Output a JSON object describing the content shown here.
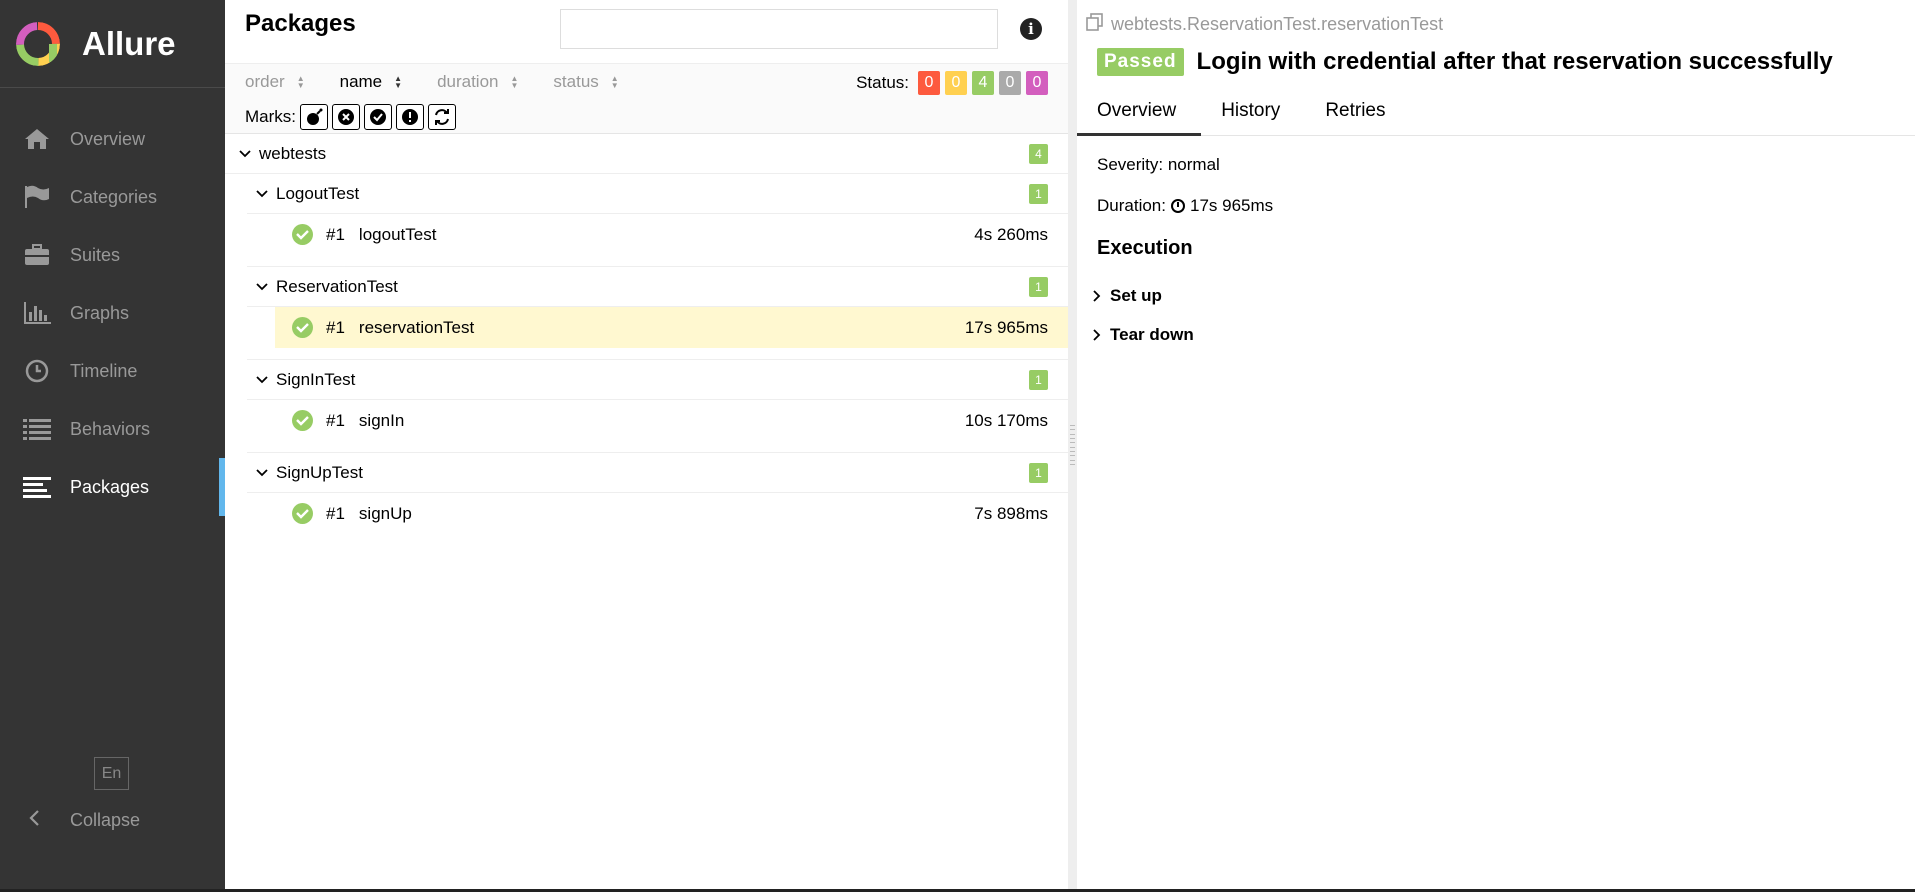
{
  "brand": {
    "name": "Allure"
  },
  "sidebar": {
    "items": [
      {
        "label": "Overview",
        "icon": "home-icon"
      },
      {
        "label": "Categories",
        "icon": "flag-icon"
      },
      {
        "label": "Suites",
        "icon": "briefcase-icon"
      },
      {
        "label": "Graphs",
        "icon": "bar-chart-icon"
      },
      {
        "label": "Timeline",
        "icon": "clock-icon"
      },
      {
        "label": "Behaviors",
        "icon": "list-icon"
      },
      {
        "label": "Packages",
        "icon": "align-left-icon"
      }
    ],
    "active": "Packages",
    "language": "En",
    "collapse_label": "Collapse"
  },
  "packages": {
    "title": "Packages",
    "search_value": "",
    "sort": {
      "order": "order",
      "name": "name",
      "duration": "duration",
      "status": "status"
    },
    "status_label": "Status:",
    "status_counts": [
      {
        "value": "0",
        "color": "#fd5a3e"
      },
      {
        "value": "0",
        "color": "#ffd050"
      },
      {
        "value": "4",
        "color": "#97cc64"
      },
      {
        "value": "0",
        "color": "#aaaaaa"
      },
      {
        "value": "0",
        "color": "#d35ebe"
      }
    ],
    "marks_label": "Marks:",
    "root": {
      "name": "webtests",
      "count": "4"
    },
    "groups": [
      {
        "name": "LogoutTest",
        "count": "1",
        "test": {
          "num": "#1",
          "name": "logoutTest",
          "duration": "4s 260ms"
        }
      },
      {
        "name": "ReservationTest",
        "count": "1",
        "test": {
          "num": "#1",
          "name": "reservationTest",
          "duration": "17s 965ms"
        }
      },
      {
        "name": "SignInTest",
        "count": "1",
        "test": {
          "num": "#1",
          "name": "signIn",
          "duration": "10s 170ms"
        }
      },
      {
        "name": "SignUpTest",
        "count": "1",
        "test": {
          "num": "#1",
          "name": "signUp",
          "duration": "7s 898ms"
        }
      }
    ]
  },
  "detail": {
    "path": "webtests.ReservationTest.reservationTest",
    "status": "Passed",
    "title": "Login with credential after that reservation successfully",
    "tabs": [
      "Overview",
      "History",
      "Retries"
    ],
    "severity": "Severity: normal",
    "duration_label": "Duration:",
    "duration_value": "17s 965ms",
    "execution_title": "Execution",
    "steps": [
      "Set up",
      "Tear down"
    ]
  },
  "colors": {
    "sidebar_bg": "#343434",
    "accent": "#62b7ec",
    "passed": "#97cc64",
    "selected_row": "#fff8d0"
  }
}
